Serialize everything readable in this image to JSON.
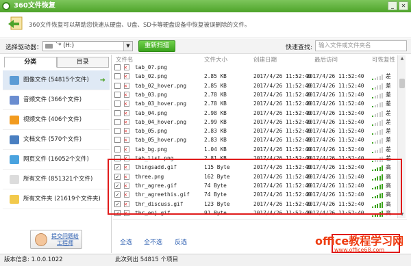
{
  "window": {
    "title": "360文件恢复"
  },
  "header": {
    "description": "360文件恢复可以帮助您快速从硬盘、U盘、SD卡等硬盘设备中恢复被误删除的文件。"
  },
  "toolbar": {
    "drive_label": "选择驱动器：",
    "drive_value": "`* (H:)",
    "rescan_label": "重新扫描",
    "quick_search_label": "快速查找:",
    "quick_search_placeholder": "输入文件或文件夹名"
  },
  "tabs": [
    "分类",
    "目录"
  ],
  "categories": [
    {
      "label": "图像文件 (54815个文件)",
      "icon": "image-icon"
    },
    {
      "label": "音频文件 (366个文件)",
      "icon": "music-icon"
    },
    {
      "label": "视频文件 (406个文件)",
      "icon": "video-icon"
    },
    {
      "label": "文档文件 (570个文件)",
      "icon": "document-icon"
    },
    {
      "label": "网页文件 (16052个文件)",
      "icon": "webpage-icon"
    },
    {
      "label": "所有文件 (851321个文件)",
      "icon": "file-icon"
    },
    {
      "label": "所有文件夹 (21619个文件夹)",
      "icon": "folder-icon"
    }
  ],
  "help_button": "提交问题给工程师",
  "columns": {
    "name": "文件名",
    "size": "文件大小",
    "created": "创建日期",
    "modified": "最后访问",
    "recover": "可恢复性"
  },
  "files": [
    {
      "name": "tab_0?.png",
      "size": "",
      "created": "",
      "modified": "",
      "quality": "",
      "checked": false,
      "bars": 0
    },
    {
      "name": "tab_02.png",
      "size": "2.85 KB",
      "created": "2017/4/26 11:52:40",
      "modified": "2017/4/26 11:52:40",
      "quality": "差",
      "checked": false,
      "bars": 1
    },
    {
      "name": "tab_02_hover.png",
      "size": "2.85 KB",
      "created": "2017/4/26 11:52:40",
      "modified": "2017/4/26 11:52:40",
      "quality": "差",
      "checked": false,
      "bars": 1
    },
    {
      "name": "tab_03.png",
      "size": "2.78 KB",
      "created": "2017/4/26 11:52:40",
      "modified": "2017/4/26 11:52:40",
      "quality": "差",
      "checked": false,
      "bars": 1
    },
    {
      "name": "tab_03_hover.png",
      "size": "2.78 KB",
      "created": "2017/4/26 11:52:40",
      "modified": "2017/4/26 11:52:40",
      "quality": "差",
      "checked": false,
      "bars": 1
    },
    {
      "name": "tab_04.png",
      "size": "2.98 KB",
      "created": "2017/4/26 11:52:40",
      "modified": "2017/4/26 11:52:40",
      "quality": "差",
      "checked": false,
      "bars": 1
    },
    {
      "name": "tab_04_hover.png",
      "size": "2.99 KB",
      "created": "2017/4/26 11:52:40",
      "modified": "2017/4/26 11:52:40",
      "quality": "差",
      "checked": false,
      "bars": 1
    },
    {
      "name": "tab_05.png",
      "size": "2.83 KB",
      "created": "2017/4/26 11:52:40",
      "modified": "2017/4/26 11:52:40",
      "quality": "差",
      "checked": false,
      "bars": 1
    },
    {
      "name": "tab_05_hover.png",
      "size": "2.83 KB",
      "created": "2017/4/26 11:52:40",
      "modified": "2017/4/26 11:52:40",
      "quality": "差",
      "checked": false,
      "bars": 1
    },
    {
      "name": "tab_bg.png",
      "size": "1.04 KB",
      "created": "2017/4/26 11:52:40",
      "modified": "2017/4/26 11:52:40",
      "quality": "差",
      "checked": false,
      "bars": 1
    },
    {
      "name": "tab_list.png",
      "size": "2.81 KB",
      "created": "2017/4/26 11:52:40",
      "modified": "2017/4/26 11:52:40",
      "quality": "差",
      "checked": false,
      "bars": 1
    },
    {
      "name": "thingsadd.gif",
      "size": "115 Byte",
      "created": "2017/4/26 11:52:40",
      "modified": "2017/4/26 11:52:40",
      "quality": "高",
      "checked": true,
      "bars": 5
    },
    {
      "name": "three.png",
      "size": "162 Byte",
      "created": "2017/4/26 11:52:40",
      "modified": "2017/4/26 11:52:40",
      "quality": "高",
      "checked": true,
      "bars": 5
    },
    {
      "name": "thr_agree.gif",
      "size": "74 Byte",
      "created": "2017/4/26 11:52:40",
      "modified": "2017/4/26 11:52:40",
      "quality": "高",
      "checked": true,
      "bars": 5
    },
    {
      "name": "thr_agreethis.gif",
      "size": "74 Byte",
      "created": "2017/4/26 11:52:40",
      "modified": "2017/4/26 11:52:40",
      "quality": "高",
      "checked": true,
      "bars": 5
    },
    {
      "name": "thr_discuss.gif",
      "size": "123 Byte",
      "created": "2017/4/26 11:52:40",
      "modified": "2017/4/26 11:52:40",
      "quality": "高",
      "checked": true,
      "bars": 5
    },
    {
      "name": "thr_enj.gif",
      "size": "91 Byte",
      "created": "2017/4/26 11:52:40",
      "modified": "2017/4/26 11:52:40",
      "quality": "高",
      "checked": true,
      "bars": 5
    },
    {
      "name": "thumb.jpg",
      "size": "25.36 KB",
      "created": "2017/4/26 11:52:40",
      "modified": "2017/4/26 11:52:40",
      "quality": "差",
      "checked": false,
      "bars": 1
    }
  ],
  "actions": {
    "select_all": "全选",
    "select_none": "全不选",
    "invert": "反选"
  },
  "status": {
    "version": "版本信息: 1.0.0.1022",
    "count": "此次列出 54815 个项目"
  },
  "watermark": {
    "main": "office教程学习网",
    "sub": "www.office68.com"
  },
  "colors": {
    "accent": "#4ea42a",
    "highlight": "#e01a1a",
    "link": "#2a5db0"
  }
}
